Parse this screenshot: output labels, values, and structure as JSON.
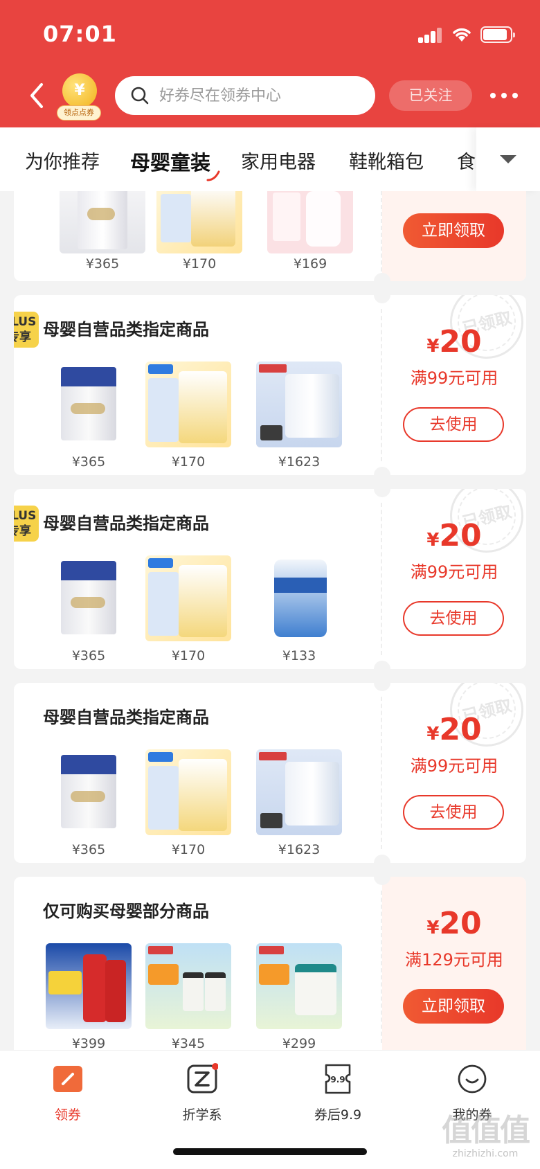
{
  "status_bar": {
    "time": "07:01"
  },
  "header": {
    "coin_symbol": "¥",
    "coin_label": "领点点券",
    "search_placeholder": "好券尽在领券中心",
    "follow_label": "已关注"
  },
  "tabs": [
    {
      "label": "为你推荐"
    },
    {
      "label": "母婴童装",
      "active": true
    },
    {
      "label": "家用电器"
    },
    {
      "label": "鞋靴箱包"
    },
    {
      "label": "食"
    }
  ],
  "coupons": [
    {
      "title": "",
      "plus": false,
      "products": [
        {
          "price": "¥365"
        },
        {
          "price": "¥170"
        },
        {
          "price": "¥169"
        }
      ],
      "currency": "",
      "amount": "",
      "condition": "",
      "button": "立即领取",
      "claimed": false,
      "stamp_text": ""
    },
    {
      "title": "母婴自营品类指定商品",
      "plus": true,
      "plus_line1": "PLUS",
      "plus_line2": "专享",
      "products": [
        {
          "price": "¥365"
        },
        {
          "price": "¥170"
        },
        {
          "price": "¥1623"
        }
      ],
      "currency": "¥",
      "amount": "20",
      "condition": "满99元可用",
      "button": "去使用",
      "claimed": true,
      "stamp_text": "已领取"
    },
    {
      "title": "母婴自营品类指定商品",
      "plus": true,
      "plus_line1": "PLUS",
      "plus_line2": "专享",
      "products": [
        {
          "price": "¥365"
        },
        {
          "price": "¥170"
        },
        {
          "price": "¥133"
        }
      ],
      "currency": "¥",
      "amount": "20",
      "condition": "满99元可用",
      "button": "去使用",
      "claimed": true,
      "stamp_text": "已领取"
    },
    {
      "title": "母婴自营品类指定商品",
      "plus": false,
      "products": [
        {
          "price": "¥365"
        },
        {
          "price": "¥170"
        },
        {
          "price": "¥1623"
        }
      ],
      "currency": "¥",
      "amount": "20",
      "condition": "满99元可用",
      "button": "去使用",
      "claimed": true,
      "stamp_text": "已领取"
    },
    {
      "title": "仅可购买母婴部分商品",
      "plus": false,
      "products": [
        {
          "price": "¥399"
        },
        {
          "price": "¥345"
        },
        {
          "price": "¥299"
        }
      ],
      "currency": "¥",
      "amount": "20",
      "condition": "满129元可用",
      "button": "立即领取",
      "claimed": false,
      "stamp_text": ""
    }
  ],
  "bottom_nav": [
    {
      "label": "领券",
      "icon": "coupon-icon",
      "active": true
    },
    {
      "label": "折学系",
      "icon": "z-icon",
      "badge_dot": true
    },
    {
      "label": "券后9.9",
      "icon": "ticket-99-icon",
      "icon_text": "9.9"
    },
    {
      "label": "我的券",
      "icon": "smile-icon"
    }
  ],
  "watermark": {
    "big": "值值值",
    "small": "zhizhizhi.com"
  },
  "colors": {
    "brand_red": "#e84440",
    "price_red": "#e8382a",
    "plus_yellow": "#f6d24a"
  }
}
